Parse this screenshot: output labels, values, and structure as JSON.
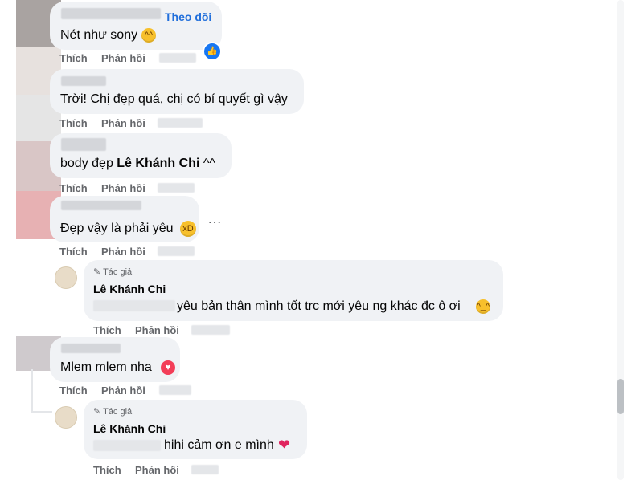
{
  "comments": [
    {
      "text": "Nét như sony",
      "follow": "Theo dõi",
      "like": "Thích",
      "reply": "Phản hồi"
    },
    {
      "text": "Trời! Chị đẹp quá, chị có bí quyết gì vậy",
      "like": "Thích",
      "reply": "Phản hồi"
    },
    {
      "text_prefix": "body đẹp ",
      "mention": "Lê Khánh Chi",
      "text_suffix": " ^^",
      "like": "Thích",
      "reply": "Phản hồi"
    },
    {
      "text": "Đẹp vậy là phải yêu",
      "like": "Thích",
      "reply": "Phản hồi",
      "more": "…"
    },
    {
      "author_tag": "Tác giả",
      "author": "Lê Khánh Chi",
      "text": "yêu bản thân mình tốt trc mới yêu ng khác đc ô ơi",
      "like": "Thích",
      "reply": "Phản hồi"
    },
    {
      "text": "Mlem mlem nha",
      "like": "Thích",
      "reply": "Phản hồi"
    },
    {
      "author_tag": "Tác giả",
      "author": "Lê Khánh Chi",
      "text": "hihi cảm ơn e mình",
      "like": "Thích",
      "reply": "Phản hồi"
    }
  ],
  "colors": {
    "bubble": "#f0f2f5",
    "link": "#216fdb",
    "meta": "#65676b",
    "like_badge": "#1877f2"
  },
  "icons": [
    "grinning-squinting-emoji",
    "like-badge",
    "laughing-emoji",
    "smiling-emoji",
    "heart-emoji",
    "red-heart-emoji",
    "pencil-icon"
  ]
}
